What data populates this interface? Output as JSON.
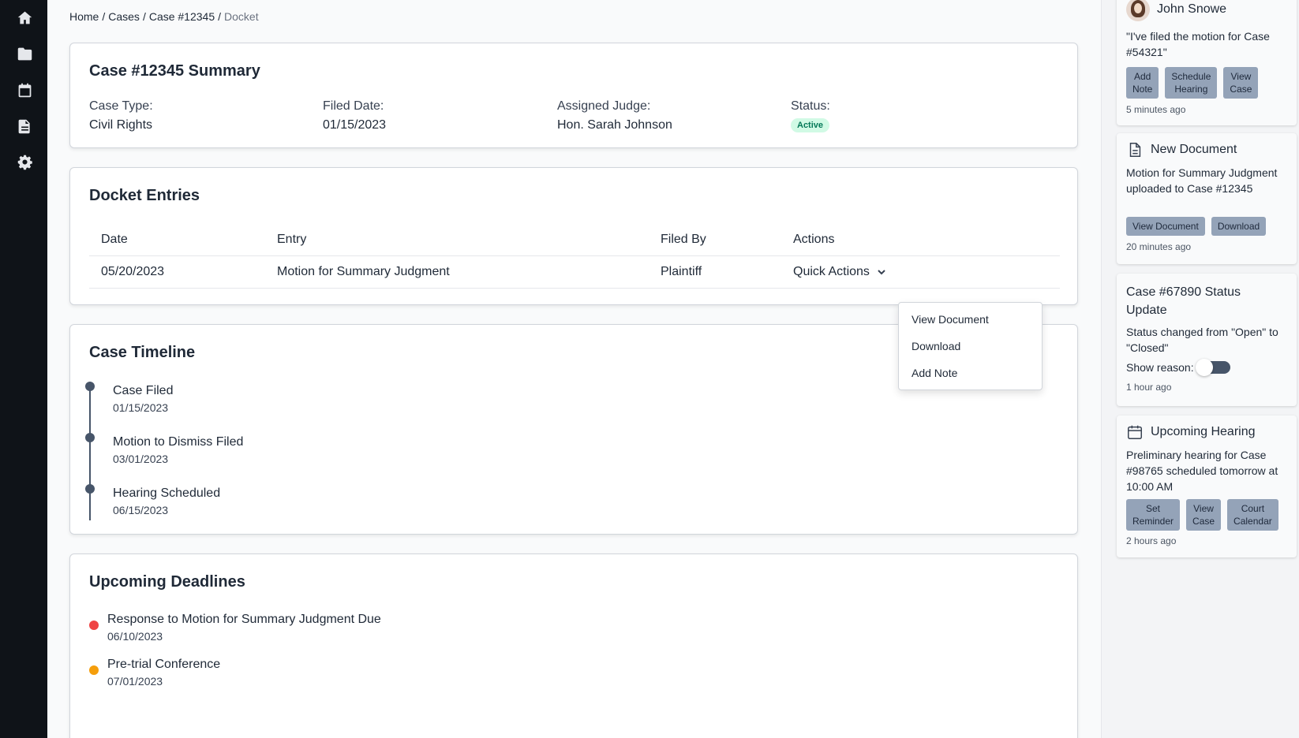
{
  "rail": {
    "items": [
      "home-icon",
      "folder-icon",
      "calendar-icon",
      "document-icon",
      "gear-icon"
    ]
  },
  "breadcrumb": {
    "items": [
      "Home",
      "Cases",
      "Case #12345"
    ],
    "current": "Docket",
    "separator": "/"
  },
  "summary": {
    "title": "Case #12345 Summary",
    "case_type_label": "Case Type:",
    "case_type": "Civil Rights",
    "filed_date_label": "Filed Date:",
    "filed_date": "01/15/2023",
    "judge_label": "Assigned Judge:",
    "judge": "Hon. Sarah Johnson",
    "status_label": "Status:",
    "status": "Active"
  },
  "docket": {
    "title": "Docket Entries",
    "columns": [
      "Date",
      "Entry",
      "Filed By",
      "Actions"
    ],
    "rows": [
      {
        "date": "05/20/2023",
        "entry": "Motion for Summary Judgment",
        "filed_by": "Plaintiff",
        "action": "Quick Actions"
      }
    ],
    "dropdown": [
      "View Document",
      "Download",
      "Add Note"
    ]
  },
  "timeline": {
    "title": "Case Timeline",
    "events": [
      {
        "title": "Case Filed",
        "date": "01/15/2023"
      },
      {
        "title": "Motion to Dismiss Filed",
        "date": "03/01/2023"
      },
      {
        "title": "Hearing Scheduled",
        "date": "06/15/2023"
      }
    ]
  },
  "deadlines": {
    "title": "Upcoming Deadlines",
    "items": [
      {
        "title": "Response to Motion for Summary Judgment Due",
        "date": "06/10/2023",
        "color": "#ef4444"
      },
      {
        "title": "Pre-trial Conference",
        "date": "07/01/2023",
        "color": "#f59e0b"
      }
    ]
  },
  "notifications": [
    {
      "title": "John Snowe",
      "body": "\"I've filed the motion for Case #54321\"",
      "buttons": [
        "Add\nNote",
        "Schedule\nHearing",
        "View\nCase"
      ],
      "time": "5 minutes ago"
    },
    {
      "title": "New Document",
      "body": "Motion for Summary Judgment uploaded to Case #12345",
      "buttons": [
        "View Document",
        "Download"
      ],
      "time": "20 minutes ago"
    },
    {
      "title": "Case #67890 Status Update",
      "body": "Status changed from \"Open\" to \"Closed\"",
      "toggle_label": "Show reason:",
      "time": "1 hour ago"
    },
    {
      "title": "Upcoming Hearing",
      "body": "Preliminary hearing for Case #98765 scheduled tomorrow at 10:00 AM",
      "buttons": [
        "Set\nReminder",
        "View\nCase",
        "Court\nCalendar"
      ],
      "time": "2 hours ago"
    }
  ]
}
